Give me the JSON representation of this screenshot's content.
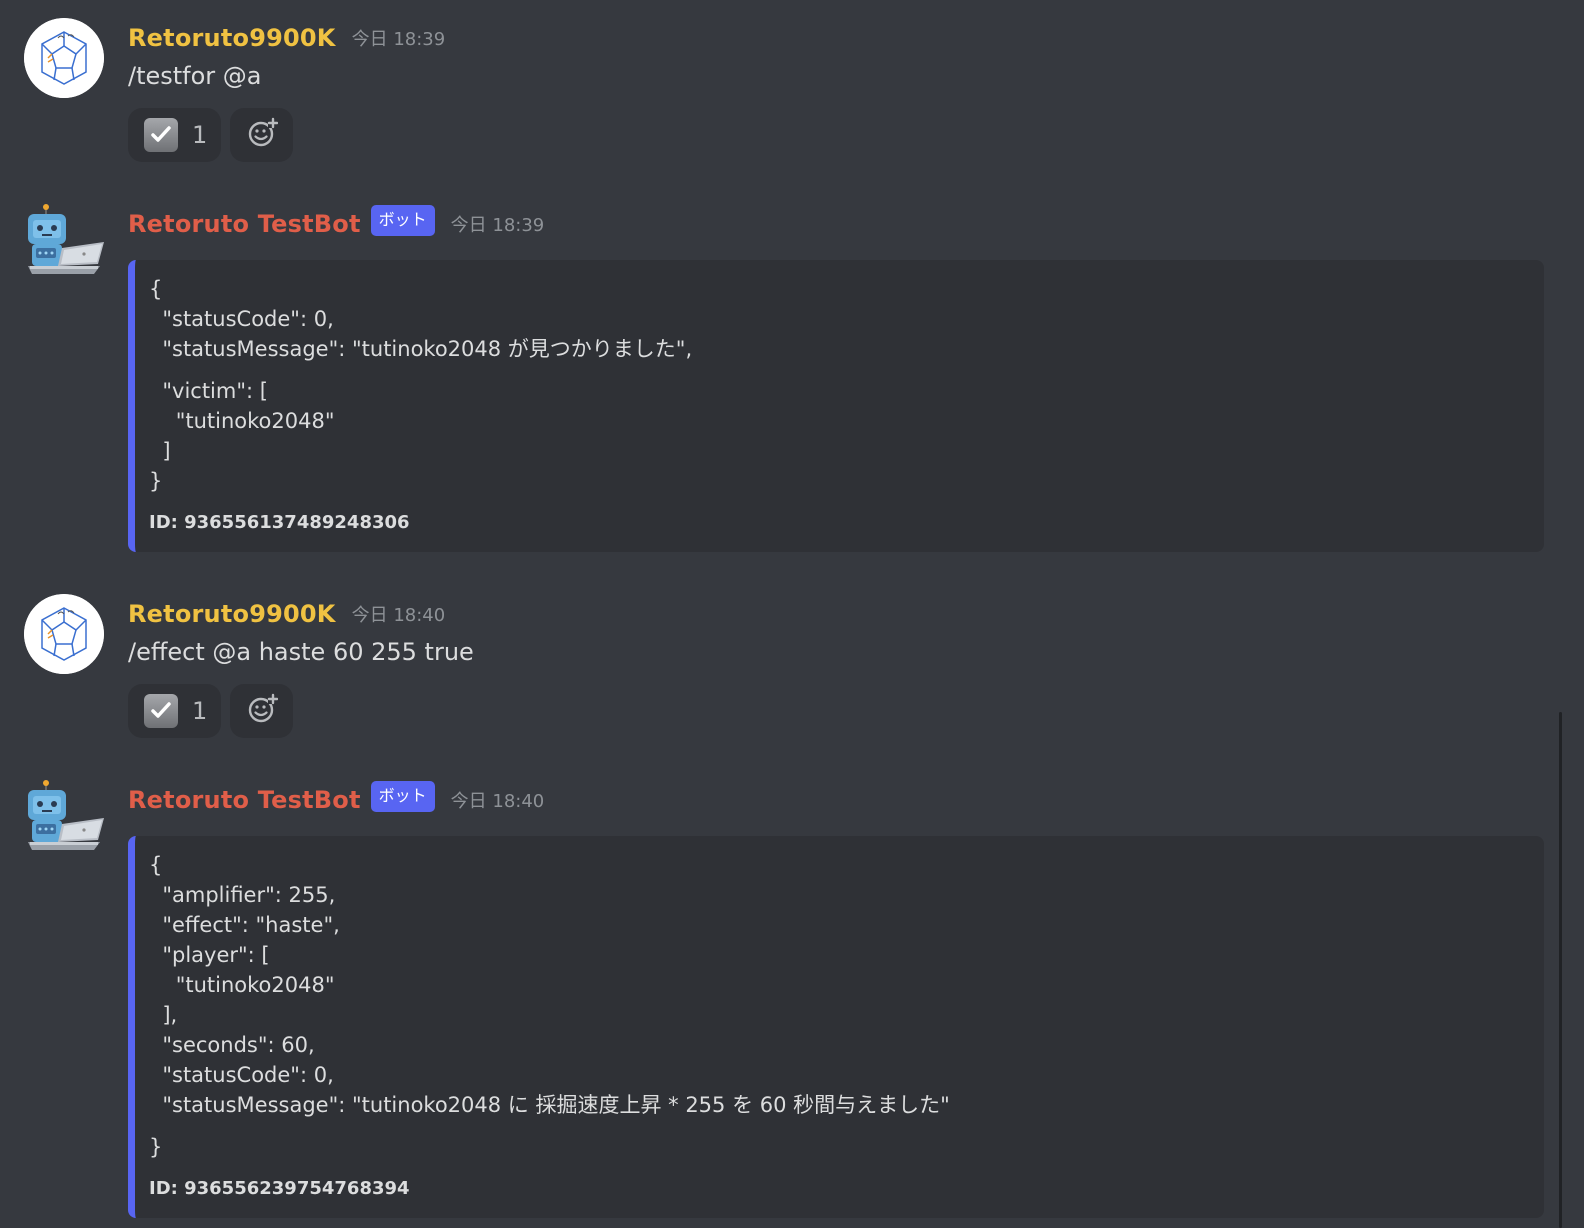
{
  "messages": [
    {
      "username": "Retoruto9900K",
      "timestamp": "今日 18:39",
      "content": "/testfor @a",
      "reactions": [
        {
          "emoji": "check-mark-button",
          "count": "1"
        }
      ]
    },
    {
      "username": "Retoruto TestBot",
      "bot_tag": "ボット",
      "timestamp": "今日 18:39",
      "embed": {
        "lines": [
          "{",
          "  \"statusCode\": 0,",
          "  \"statusMessage\": \"tutinoko2048 が見つかりました\",",
          "  \"victim\": [",
          "    \"tutinoko2048\"",
          "  ]",
          "}"
        ],
        "footer": "ID: 936556137489248306"
      }
    },
    {
      "username": "Retoruto9900K",
      "timestamp": "今日 18:40",
      "content": "/effect @a haste 60 255 true",
      "reactions": [
        {
          "emoji": "check-mark-button",
          "count": "1"
        }
      ]
    },
    {
      "username": "Retoruto TestBot",
      "bot_tag": "ボット",
      "timestamp": "今日 18:40",
      "embed": {
        "lines": [
          "{",
          "  \"amplifier\": 255,",
          "  \"effect\": \"haste\",",
          "  \"player\": [",
          "    \"tutinoko2048\"",
          "  ],",
          "  \"seconds\": 60,",
          "  \"statusCode\": 0,",
          "  \"statusMessage\": \"tutinoko2048 に 採掘速度上昇 * 255 を 60 秒間与えました\"",
          "}"
        ],
        "footer": "ID: 936556239754768394"
      }
    }
  ],
  "colors": {
    "background": "#36393f",
    "user_name": "#f0c242",
    "bot_name": "#e05e49",
    "bot_tag": "#5865f2",
    "embed_bg": "#2f3136"
  }
}
